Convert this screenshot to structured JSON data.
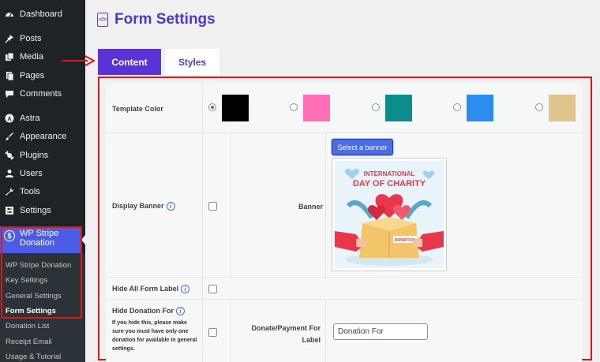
{
  "sidebar": {
    "items": [
      {
        "label": "Dashboard",
        "icon": "dashboard-icon"
      },
      {
        "label": "Posts",
        "icon": "pin-icon"
      },
      {
        "label": "Media",
        "icon": "media-icon"
      },
      {
        "label": "Pages",
        "icon": "pages-icon"
      },
      {
        "label": "Comments",
        "icon": "comments-icon"
      },
      {
        "label": "Astra",
        "icon": "astra-icon"
      },
      {
        "label": "Appearance",
        "icon": "brush-icon"
      },
      {
        "label": "Plugins",
        "icon": "plugin-icon"
      },
      {
        "label": "Users",
        "icon": "user-icon"
      },
      {
        "label": "Tools",
        "icon": "wrench-icon"
      },
      {
        "label": "Settings",
        "icon": "settings-icon"
      }
    ],
    "active_plugin": {
      "label_line1": "WP Stripe",
      "label_line2": "Donation",
      "icon": "dollar-circle-icon"
    },
    "submenu": [
      "WP Stripe Donation",
      "Key Settings",
      "General Settings",
      "Form Settings",
      "Donation List",
      "Receipt Email",
      "Usage & Tutorial"
    ]
  },
  "header": {
    "title": "Form Settings",
    "icon": "code-file-icon"
  },
  "tabs": [
    {
      "label": "Content",
      "active": true
    },
    {
      "label": "Styles",
      "active": false
    }
  ],
  "form": {
    "template_color": {
      "label": "Template Color",
      "options": [
        {
          "color": "#000000",
          "selected": true
        },
        {
          "color": "#ff6fb7",
          "selected": false
        },
        {
          "color": "#0d8c8c",
          "selected": false
        },
        {
          "color": "#2d8cf0",
          "selected": false
        },
        {
          "color": "#e2c48f",
          "selected": false
        }
      ]
    },
    "display_banner": {
      "label": "Display Banner",
      "banner_label": "Banner",
      "select_button": "Select a banner",
      "banner_title_line1": "INTERNATIONAL",
      "banner_title_line2": "DAY OF CHARITY",
      "box_label": "DONATION"
    },
    "hide_all_labels": {
      "label": "Hide All Form Label"
    },
    "hide_donation_for": {
      "label": "Hide Donation For",
      "hint": "If you hide this, please make sure you must have only one donation for available in general settings.",
      "field_label_line1": "Donate/Payment For",
      "field_label_line2": "Label",
      "input_value": "Donation For"
    }
  },
  "colors": {
    "accent": "#5a33d6",
    "sidebar_bg": "#1d2327",
    "active_menu": "#4b5de4",
    "annotation_red": "#e0161b"
  }
}
